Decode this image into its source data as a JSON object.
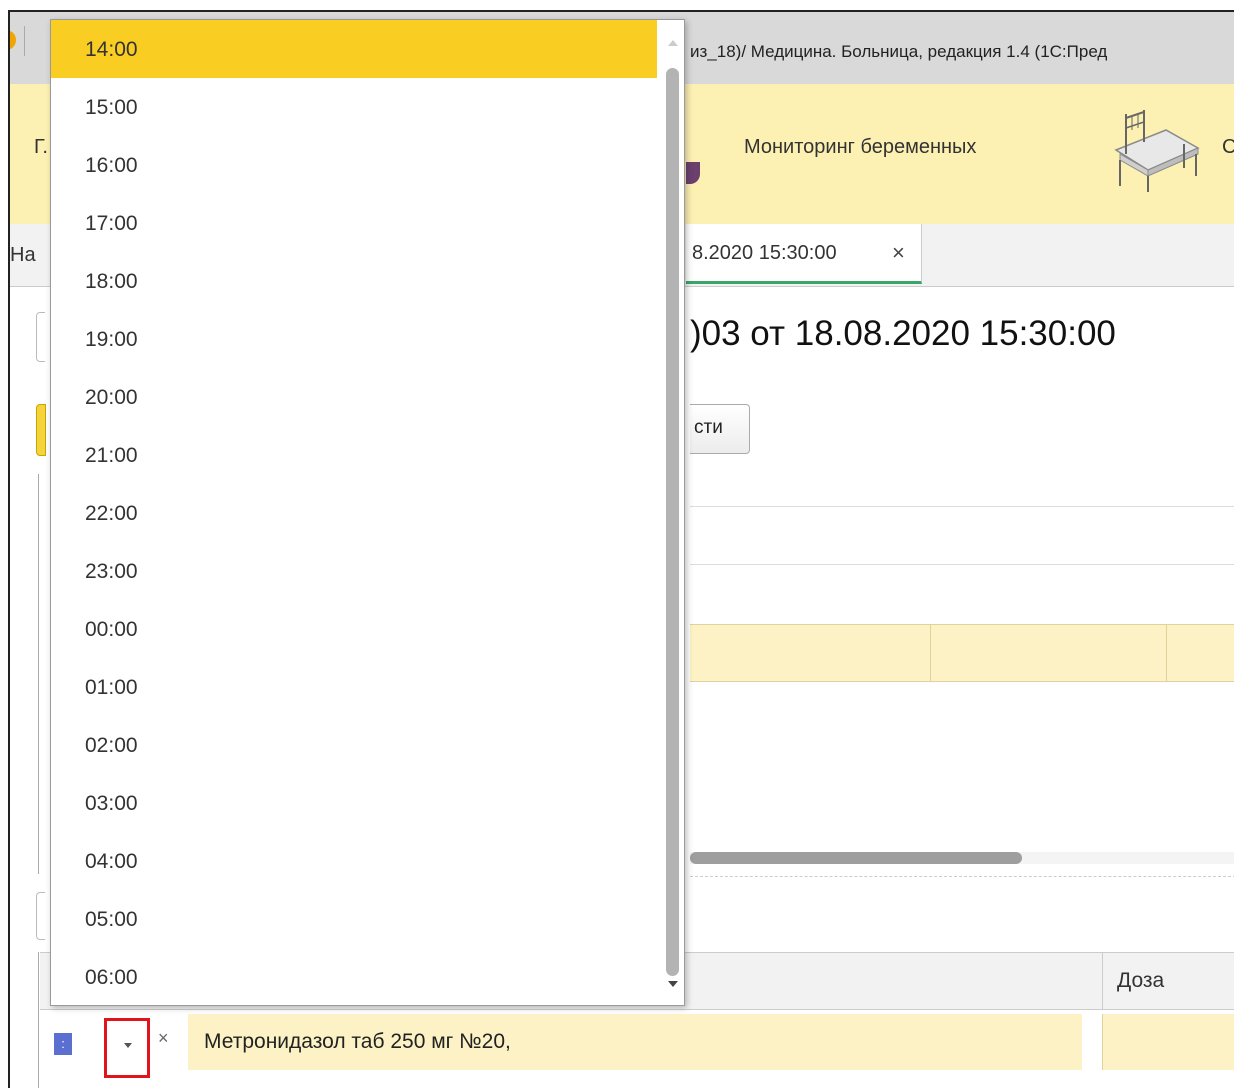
{
  "window": {
    "title": "из_18)/ Медицина. Больница, редакция 1.4  (1С:Пред"
  },
  "sections": {
    "cut_left_label": "Г.",
    "pregnancy_monitoring": "Мониторинг беременных",
    "cut_right_label": "С"
  },
  "tabs": {
    "cut_left_label": "На",
    "active_tab_label": "8.2020 15:30:00",
    "close_symbol": "×"
  },
  "document": {
    "title": ")03 от 18.08.2020 15:30:00",
    "toolbar_button_label": "сти"
  },
  "table": {
    "dose_header": "Доза",
    "row": {
      "number_marker": ":",
      "clear_symbol": "×",
      "medication": "Метронидазол таб 250 мг №20,"
    }
  },
  "time_dropdown": {
    "selected": "14:00",
    "options": [
      "14:00",
      "15:00",
      "16:00",
      "17:00",
      "18:00",
      "19:00",
      "20:00",
      "21:00",
      "22:00",
      "23:00",
      "00:00",
      "01:00",
      "02:00",
      "03:00",
      "04:00",
      "05:00",
      "06:00"
    ]
  },
  "colors": {
    "selected_option": "#facd23",
    "sections_panel": "#fcf0b3",
    "active_tab_underline": "#3aa66a",
    "highlight_frame": "#e0141a"
  }
}
